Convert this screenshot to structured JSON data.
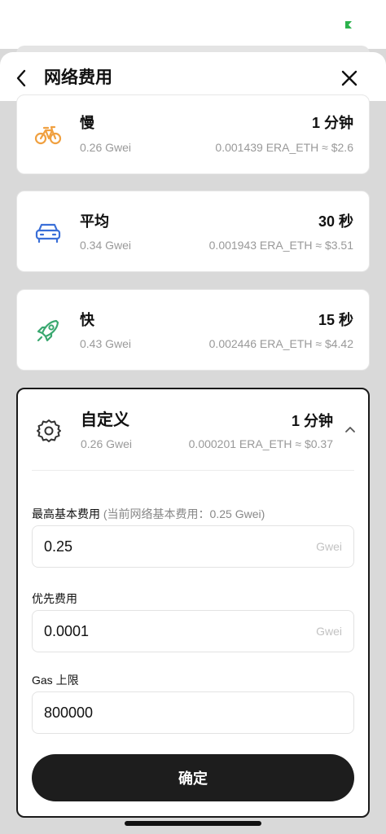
{
  "header": {
    "title": "网络费用"
  },
  "colors": {
    "status_indicator": "#2bb24c",
    "slow_icon": "#f0a040",
    "average_icon": "#3a6fd8",
    "fast_icon": "#3aa870",
    "custom_icon": "#333333",
    "confirm_button": "#1d1d1d"
  },
  "options": [
    {
      "name": "慢",
      "icon": "bicycle-icon",
      "time": "1 分钟",
      "gwei": "0.26 Gwei",
      "cost": "0.001439 ERA_ETH ≈ $2.6"
    },
    {
      "name": "平均",
      "icon": "car-icon",
      "time": "30 秒",
      "gwei": "0.34 Gwei",
      "cost": "0.001943 ERA_ETH ≈ $3.51"
    },
    {
      "name": "快",
      "icon": "rocket-icon",
      "time": "15 秒",
      "gwei": "0.43 Gwei",
      "cost": "0.002446 ERA_ETH ≈ $4.42"
    }
  ],
  "custom": {
    "name": "自定义",
    "icon": "gear-icon",
    "time": "1 分钟",
    "gwei": "0.26 Gwei",
    "cost": "0.000201 ERA_ETH ≈ $0.37",
    "fields": [
      {
        "label": "最高基本费用",
        "hint": "(当前网络基本费用：0.25 Gwei)",
        "value": "0.25",
        "unit": "Gwei"
      },
      {
        "label": "优先费用",
        "value": "0.0001",
        "unit": "Gwei"
      },
      {
        "label": "Gas 上限",
        "value": "800000"
      }
    ]
  },
  "confirm_label": "确定"
}
